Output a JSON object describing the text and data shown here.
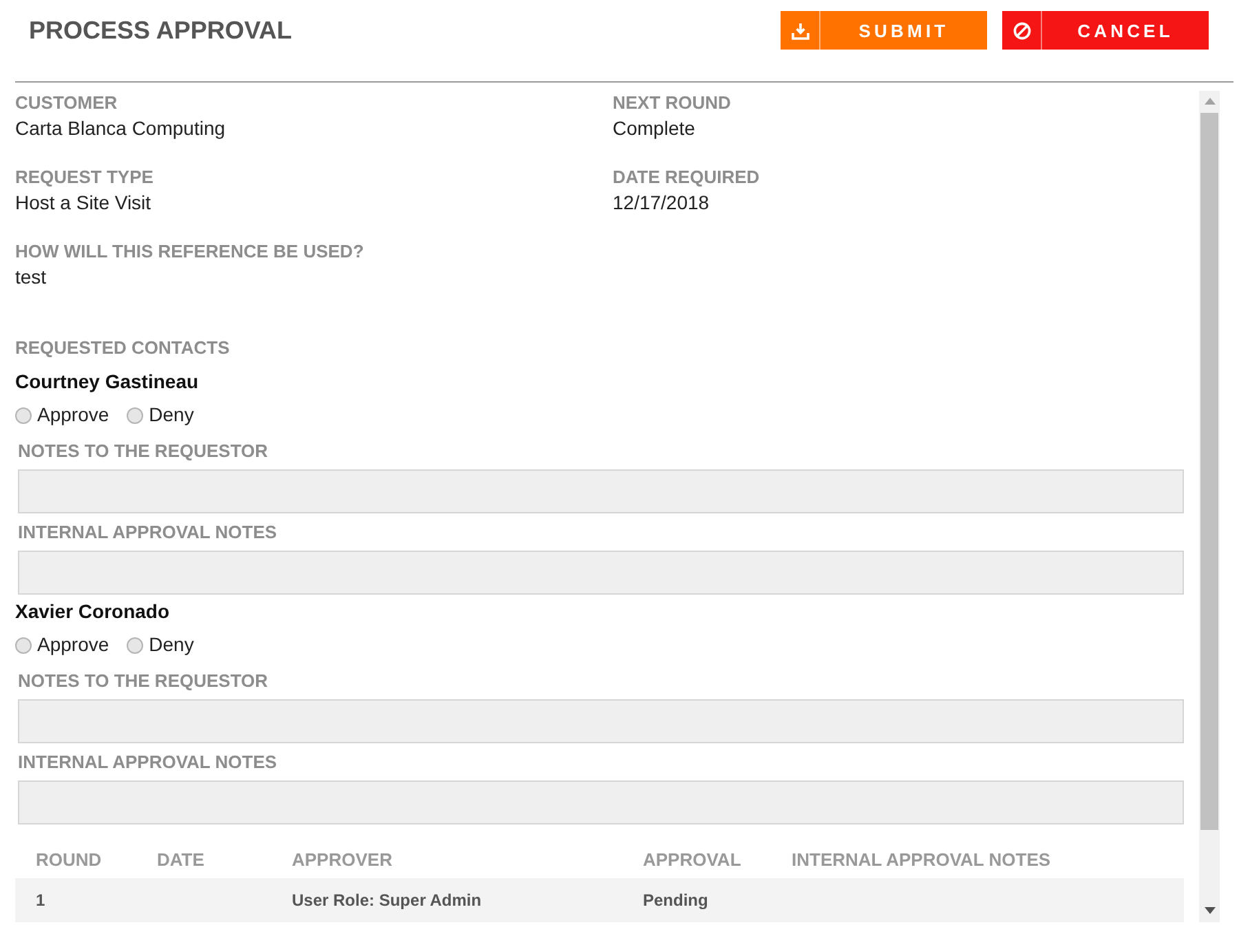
{
  "header": {
    "title": "PROCESS APPROVAL",
    "buttons": [
      {
        "label": "SUBMIT",
        "kind": "submit"
      },
      {
        "label": "CANCEL",
        "kind": "cancel"
      }
    ]
  },
  "details": [
    {
      "label": "CUSTOMER",
      "value": "Carta Blanca Computing"
    },
    {
      "label": "NEXT ROUND",
      "value": "Complete"
    },
    {
      "label": "REQUEST TYPE",
      "value": "Host a Site Visit"
    },
    {
      "label": "DATE REQUIRED",
      "value": "12/17/2018"
    },
    {
      "label": "HOW WILL THIS REFERENCE BE USED?",
      "value": "test"
    }
  ],
  "contacts": {
    "heading": "REQUESTED CONTACTS",
    "items": [
      {
        "name": "Courtney Gastineau",
        "options": [
          {
            "label": "Approve",
            "selected": false
          },
          {
            "label": "Deny",
            "selected": false
          }
        ],
        "fields": [
          {
            "label": "NOTES TO THE REQUESTOR"
          },
          {
            "label": "INTERNAL APPROVAL NOTES"
          }
        ]
      },
      {
        "name": "Xavier Coronado",
        "options": [
          {
            "label": "Approve",
            "selected": false
          },
          {
            "label": "Deny",
            "selected": false
          }
        ],
        "fields": [
          {
            "label": "NOTES TO THE REQUESTOR"
          },
          {
            "label": "INTERNAL APPROVAL NOTES"
          }
        ]
      }
    ]
  },
  "rounds_table": {
    "columns": [
      "ROUND",
      "DATE",
      "APPROVER",
      "APPROVAL",
      "INTERNAL APPROVAL NOTES"
    ],
    "rows": [
      {
        "round": "1",
        "approver": "User Role: Super Admin",
        "approval": "Pending"
      }
    ]
  }
}
